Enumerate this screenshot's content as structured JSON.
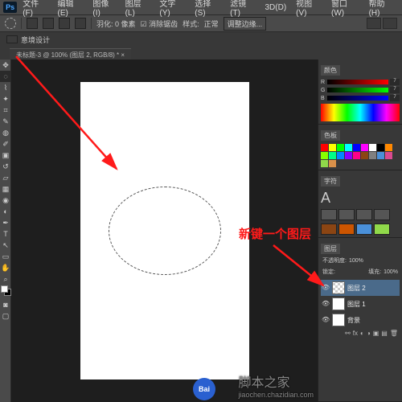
{
  "app": {
    "logo": "Ps"
  },
  "menu": {
    "file": "文件(F)",
    "edit": "编辑(E)",
    "image": "图像(I)",
    "layer": "图层(L)",
    "type": "文字(Y)",
    "select": "选择(S)",
    "filter": "滤镜(T)",
    "threeD": "3D(D)",
    "view": "视图(V)",
    "window": "窗口(W)",
    "help": "帮助(H)"
  },
  "optbar": {
    "feather": "羽化: 0 像素",
    "antialias": "消除锯齿",
    "style": "样式:",
    "style_val": "正常",
    "refine": "调整边缘..."
  },
  "breadcrumb": {
    "label": "意境设计"
  },
  "doc_tab": "未标题-3 @ 100% (图层 2, RGB/8) * ×",
  "color_panel": {
    "tab": "颜色",
    "r": "R",
    "r_val": "7",
    "g": "G",
    "g_val": "7",
    "b": "B",
    "b_val": "7"
  },
  "swatches_panel": {
    "tab": "色板"
  },
  "char_panel": {
    "tab": "字符"
  },
  "layers_panel": {
    "tab": "图层",
    "opacity_label": "不透明度:",
    "opacity_val": "100%",
    "fill_label": "填充:",
    "fill_val": "100%",
    "lock": "锁定:",
    "layers": [
      {
        "name": "图层 2",
        "selected": true,
        "white": false
      },
      {
        "name": "图层 1",
        "selected": false,
        "white": true
      },
      {
        "name": "背景",
        "selected": false,
        "white": true
      }
    ]
  },
  "annotation": {
    "text": "新键一个图层"
  },
  "watermark": {
    "main": "脚本之家",
    "url": "jiaochen.chazidian.com",
    "bai": "Bai"
  },
  "swatch_colors": [
    "#ff0000",
    "#ffff00",
    "#00ff00",
    "#00ffff",
    "#0000ff",
    "#ff00ff",
    "#ffffff",
    "#000000",
    "#ff8800",
    "#88ff00",
    "#00ff88",
    "#0088ff",
    "#8800ff",
    "#ff0088",
    "#8B4513",
    "#808080",
    "#4a90d9",
    "#d94a90",
    "#90d94a",
    "#d9904a"
  ]
}
